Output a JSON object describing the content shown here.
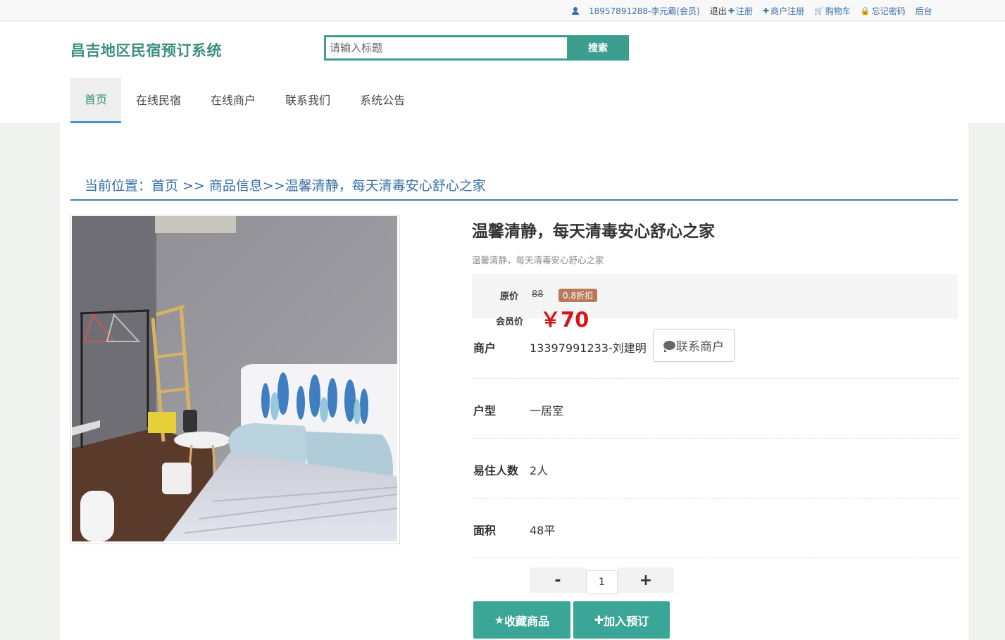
{
  "topbar": {
    "user": "18957891288-李元霸(会员)",
    "logout": "退出",
    "register": "注册",
    "merchant_register": "商户注册",
    "cart": "购物车",
    "forgot_password": "忘记密码",
    "admin": "后台"
  },
  "header": {
    "logo": "昌吉地区民宿预订系统",
    "search_placeholder": "请输入标题",
    "search_button": "搜索"
  },
  "nav": [
    "首页",
    "在线民宿",
    "在线商户",
    "联系我们",
    "系统公告"
  ],
  "breadcrumb": "当前位置：首页 >> 商品信息>>温馨清静，每天清毒安心舒心之家",
  "product": {
    "title": "温馨清静，每天清毒安心舒心之家",
    "subtitle": "温馨清静，每天清毒安心舒心之家",
    "original_price_label": "原价",
    "original_price": "88",
    "discount_badge": "0.8折扣",
    "member_price_label": "会员价",
    "member_price": "￥70",
    "merchant_label": "商户",
    "merchant_value": "13397991233-刘建明",
    "contact_button": "联系商户",
    "type_label": "户型",
    "type_value": "一居室",
    "capacity_label": "易住人数",
    "capacity_value": "2人",
    "area_label": "面积",
    "area_value": "48平",
    "quantity": "1",
    "minus": "-",
    "plus": "+",
    "favorite_button": "收藏商品",
    "book_button": "加入预订"
  }
}
